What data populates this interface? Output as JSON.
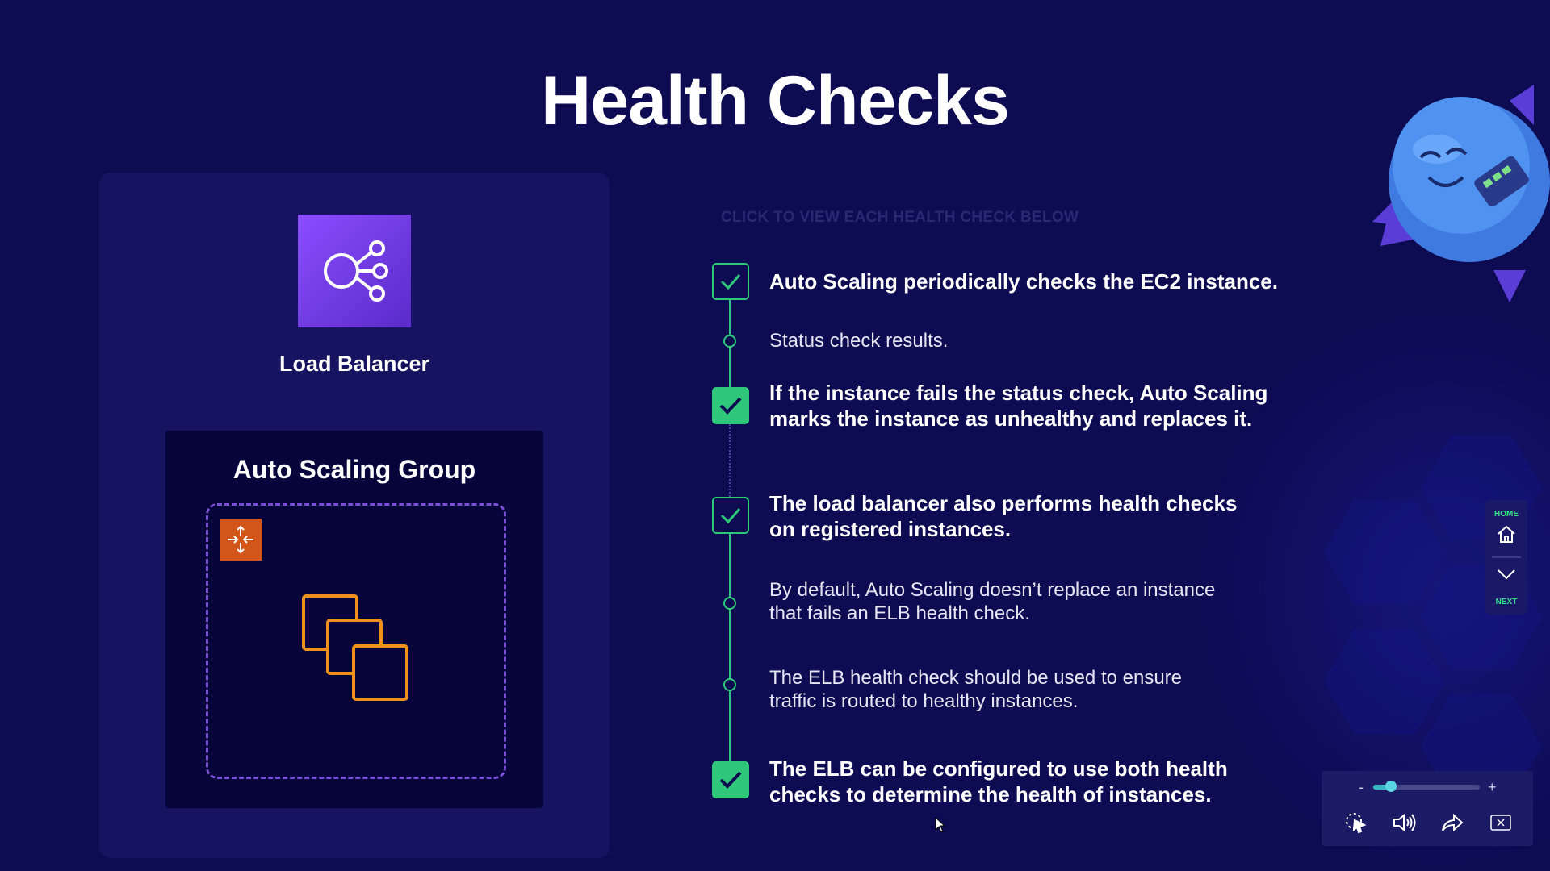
{
  "title": "Health Checks",
  "left_panel": {
    "load_balancer_label": "Load Balancer",
    "asg_label": "Auto Scaling Group"
  },
  "instruction": "CLICK TO VIEW EACH HEALTH CHECK BELOW",
  "items": [
    {
      "text": "Auto Scaling periodically checks the EC2 instance.",
      "style": "bold",
      "marker": "check-outline"
    },
    {
      "text": "Status check results.",
      "style": "sub",
      "marker": "node"
    },
    {
      "line1": "If the instance fails the status check, Auto Scaling",
      "line2": "marks the instance as unhealthy and replaces it.",
      "style": "bold",
      "marker": "check-filled"
    },
    {
      "line1": "The load balancer also performs health checks",
      "line2": "on registered instances.",
      "style": "bold",
      "marker": "check-outline"
    },
    {
      "line1": "By default, Auto Scaling doesn’t replace an instance",
      "line2": "that fails an ELB health check.",
      "style": "sub",
      "marker": "node"
    },
    {
      "line1": "The ELB health check should be used to ensure",
      "line2": "traffic is routed to healthy instances.",
      "style": "sub",
      "marker": "node"
    },
    {
      "line1": "The ELB can be configured to use both health",
      "line2": "checks to determine the health of instances.",
      "style": "bold",
      "marker": "check-filled"
    }
  ],
  "side_nav": {
    "home_label": "HOME",
    "next_label": "NEXT"
  },
  "player": {
    "minus": "-",
    "plus": "+",
    "volume_level": 0.17
  },
  "colors": {
    "background": "#0d0b52",
    "accent_green": "#2fc87a",
    "lb_purple": "#7b3ff0",
    "asg_orange": "#d2561b",
    "ec2_orange": "#f0901c"
  }
}
